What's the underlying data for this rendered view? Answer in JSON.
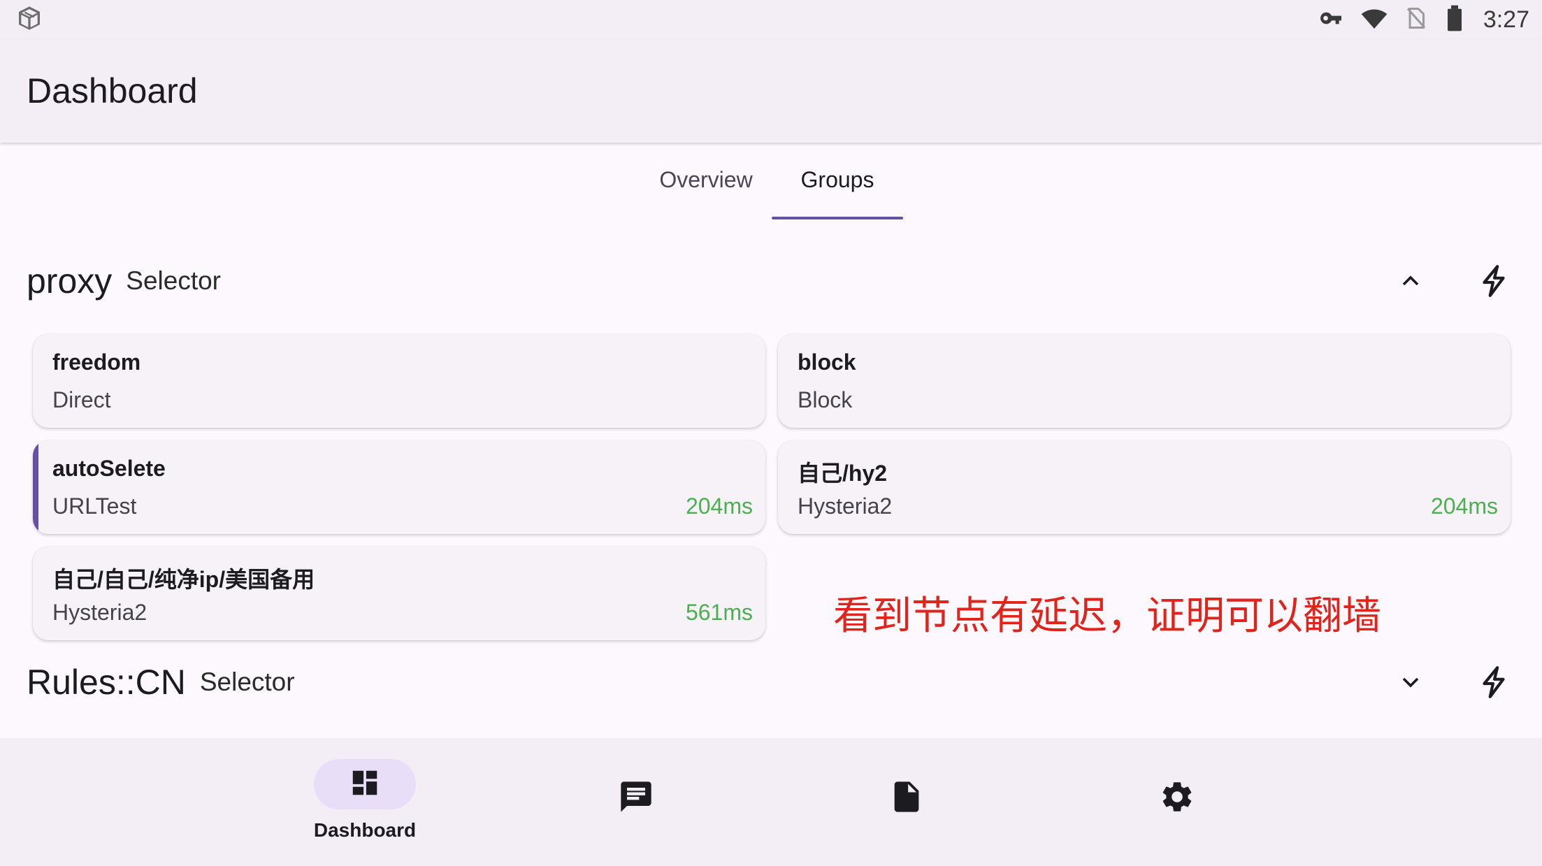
{
  "status_bar": {
    "app_icon": "cube-icon",
    "icons": [
      "vpn-key-icon",
      "wifi-icon",
      "no-sim-icon",
      "battery-icon"
    ],
    "time": "3:27"
  },
  "app_bar": {
    "title": "Dashboard"
  },
  "tabs": [
    {
      "label": "Overview",
      "active": false
    },
    {
      "label": "Groups",
      "active": true
    }
  ],
  "groups": [
    {
      "name": "proxy",
      "type": "Selector",
      "expanded": true,
      "proxies": [
        {
          "name": "freedom",
          "type": "Direct",
          "latency": "",
          "selected": false
        },
        {
          "name": "block",
          "type": "Block",
          "latency": "",
          "selected": false
        },
        {
          "name": "autoSelete",
          "type": "URLTest",
          "latency": "204ms",
          "selected": true
        },
        {
          "name": "自己/hy2",
          "type": "Hysteria2",
          "latency": "204ms",
          "selected": false
        },
        {
          "name": "自己/自己/纯净ip/美国备用",
          "type": "Hysteria2",
          "latency": "561ms",
          "selected": false
        }
      ]
    },
    {
      "name": "Rules::CN",
      "type": "Selector",
      "expanded": false,
      "proxies": []
    }
  ],
  "annotation": "看到节点有延迟，证明可以翻墙",
  "bottom_nav": [
    {
      "label": "Dashboard",
      "icon": "dashboard-icon",
      "active": true
    },
    {
      "label": "",
      "icon": "message-icon",
      "active": false
    },
    {
      "label": "",
      "icon": "document-icon",
      "active": false
    },
    {
      "label": "",
      "icon": "gear-icon",
      "active": false
    }
  ],
  "colors": {
    "accent": "#6750a4",
    "latency_good": "#4caf50",
    "annotation": "#e0241b"
  }
}
